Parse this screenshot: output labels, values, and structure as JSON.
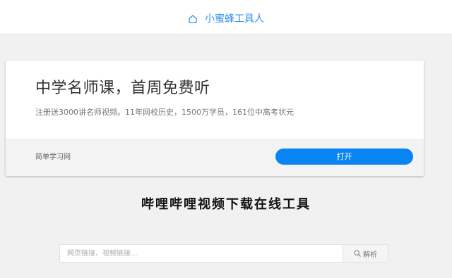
{
  "header": {
    "icon": "home-icon",
    "title": "小蜜蜂工具人",
    "color": "#2b8ff0"
  },
  "ad": {
    "title": "中学名师课，首周免费听",
    "description": "注册送3000讲名师视频。11年网校历史，1500万学员，161位中高考状元",
    "source": "简单学习网",
    "open_label": "打开",
    "button_color": "#0a84f3"
  },
  "main": {
    "heading": "哔哩哔哩视频下载在线工具"
  },
  "search": {
    "placeholder": "网页链接、视频链接...",
    "value": "",
    "button_icon": "search-icon",
    "button_label": "解析"
  }
}
